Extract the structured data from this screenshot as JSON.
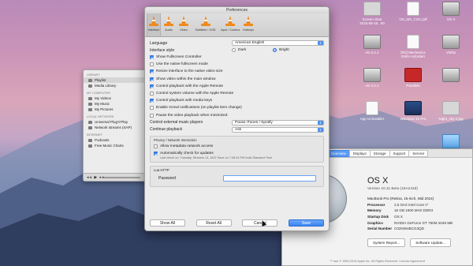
{
  "desktop": {
    "icons": [
      {
        "label": "Screen Shot\n2015-06-16...50",
        "kind": "shot",
        "pos": "s1"
      },
      {
        "label": "OS_MX_CSC.pdf",
        "kind": "doc",
        "pos": "s2"
      },
      {
        "label": "OS X",
        "kind": "drive",
        "pos": "s3"
      },
      {
        "label": "vlc-2.2.1",
        "kind": "drive",
        "pos": "s4"
      },
      {
        "label": "[RZ] Mechanics\nEWH Anforderi",
        "kind": "doc",
        "pos": "s5"
      },
      {
        "label": "Vishlu",
        "kind": "drive",
        "pos": "s6"
      },
      {
        "label": "vlc-2.2.1",
        "kind": "drive",
        "pos": "s7"
      },
      {
        "label": "Parallels",
        "kind": "red",
        "pos": "s8"
      },
      {
        "label": "",
        "kind": "drive",
        "pos": "s9"
      },
      {
        "label": "App Uninstaller",
        "kind": "doc",
        "pos": "s10"
      },
      {
        "label": "Windows 10 Pro",
        "kind": "win",
        "pos": "s11"
      },
      {
        "label": "Night_sky-2.jpg",
        "kind": "shot",
        "pos": "s12"
      },
      {
        "label": "untitled folder",
        "kind": "folder",
        "pos": "s13"
      }
    ]
  },
  "vlc_window": {
    "sections": [
      {
        "header": "LIBRARY",
        "items": [
          "Playlist",
          "Media Library"
        ],
        "selected": 0
      },
      {
        "header": "MY COMPUTER",
        "items": [
          "My Videos",
          "My Music",
          "My Pictures"
        ]
      },
      {
        "header": "LOCAL NETWORK",
        "items": [
          "Universal Plug'n'Play",
          "Network streams (SAP)"
        ]
      },
      {
        "header": "INTERNET",
        "items": [
          "Podcasts",
          "Free Music Charts"
        ]
      }
    ],
    "controls": "◂◂ ▶ ▸▸"
  },
  "about_window": {
    "tabs": [
      "Overview",
      "Displays",
      "Storage",
      "Support",
      "Service"
    ],
    "active_tab": 0,
    "logo_text": "X",
    "name": "OS X",
    "version": "Version 10.11 Beta (15A244d)",
    "specs": [
      {
        "k": "MacBook Pro (Retina, 15-inch, Mid 2014)",
        "v": ""
      },
      {
        "k": "Processor",
        "v": "2.5 GHz Intel Core i7"
      },
      {
        "k": "Memory",
        "v": "16 GB 1600 MHz DDR3"
      },
      {
        "k": "Startup Disk",
        "v": "OS X"
      },
      {
        "k": "Graphics",
        "v": "NVIDIA GeForce GT 750M 2048 MB"
      },
      {
        "k": "Serial Number",
        "v": "C02NW4BCG3QD"
      }
    ],
    "buttons": [
      "System Report...",
      "Software Update..."
    ],
    "footer": "™ and © 1983-2015 Apple Inc. All Rights Reserved. License Agreement"
  },
  "preferences": {
    "title": "Preferences",
    "toolbar": [
      {
        "label": "Interface",
        "active": true
      },
      {
        "label": "Audio"
      },
      {
        "label": "Video"
      },
      {
        "label": "Subtitles / OSD"
      },
      {
        "label": "Input / Codecs"
      },
      {
        "label": "Hotkeys"
      }
    ],
    "language": {
      "label": "Language",
      "value": "American English"
    },
    "interface_style": {
      "label": "Interface style",
      "options": [
        "Dark",
        "Bright"
      ],
      "selected": 1
    },
    "checkboxes": [
      {
        "label": "Show Fullscreen Controller",
        "checked": true
      },
      {
        "label": "Use the native fullscreen mode",
        "checked": false
      },
      {
        "label": "Resize interface to the native video size",
        "checked": true
      },
      {
        "label": "Show video within the main window",
        "checked": true
      },
      {
        "label": "Control playback with the Apple Remote",
        "checked": true
      },
      {
        "label": "Control system volume with the Apple Remote",
        "checked": false
      },
      {
        "label": "Control playback with media keys",
        "checked": true
      },
      {
        "label": "Enable Growl notifications (on playlist item change)",
        "checked": false
      },
      {
        "label": "Pause the video playback when minimized",
        "checked": false
      }
    ],
    "control_music": {
      "label": "Control external music players",
      "value": "Pause iTunes / Spotify"
    },
    "continue_playback": {
      "label": "Continue playback",
      "value": "Ask"
    },
    "privacy": {
      "title": "Privacy / Network Interaction",
      "items": [
        {
          "label": "Allow metadata network access",
          "checked": false
        },
        {
          "label": "Automatically check for updates",
          "checked": true
        }
      ],
      "hint": "Last check on: Tuesday, Streams 13, 1637 Save on 7:08:24 PM India Standard Time"
    },
    "lua": {
      "title": "Lua HTTP",
      "password_label": "Password",
      "password_value": ""
    },
    "buttons": {
      "show_all": "Show All",
      "reset_all": "Reset All",
      "cancel": "Cancel",
      "save": "Save"
    }
  }
}
